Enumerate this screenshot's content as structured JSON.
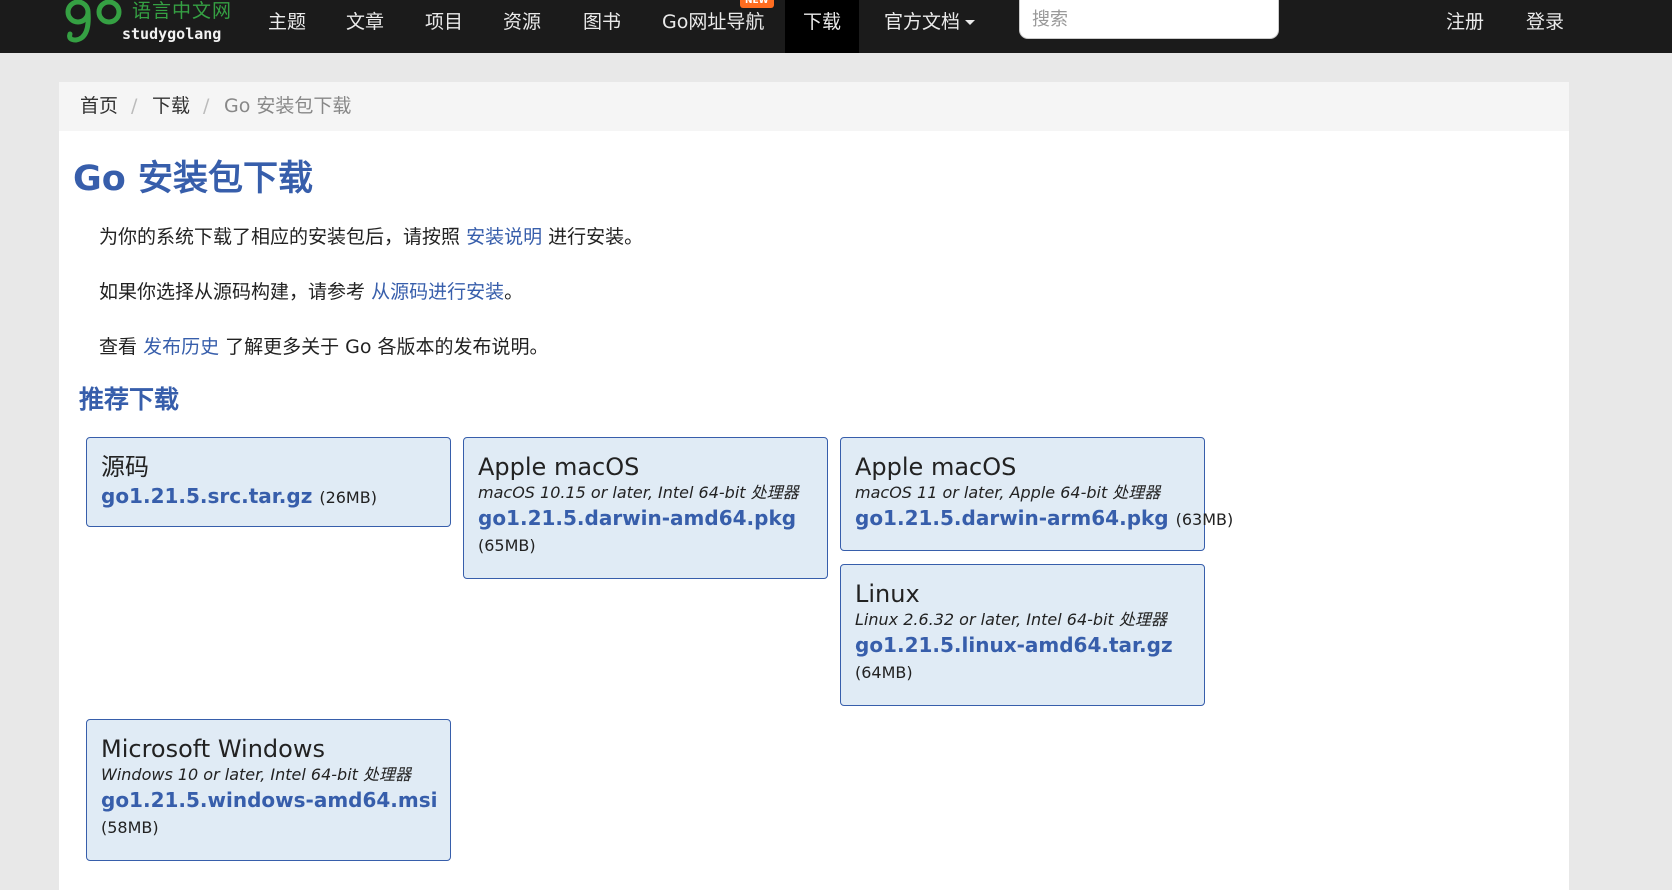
{
  "header": {
    "logo_cn": "语言中文网",
    "logo_en": "studygolang",
    "nav": [
      {
        "label": "主题"
      },
      {
        "label": "文章"
      },
      {
        "label": "项目"
      },
      {
        "label": "资源"
      },
      {
        "label": "图书"
      },
      {
        "label": "Go网址导航",
        "badge": "NEW"
      },
      {
        "label": "下载",
        "active": true
      },
      {
        "label": "官方文档"
      }
    ],
    "search_placeholder": "搜索",
    "register": "注册",
    "login": "登录"
  },
  "breadcrumb": {
    "home": "首页",
    "download": "下载",
    "sep": "/",
    "current": "Go 安装包下载"
  },
  "page_title": "Go 安装包下载",
  "paragraphs": {
    "p1_pre": "为你的系统下载了相应的安装包后，请按照",
    "p1_link": "安装说明",
    "p1_post": "进行安装。",
    "p2_pre": "如果你选择从源码构建，请参考",
    "p2_link": "从源码进行安装",
    "p2_post": "。",
    "p3_pre": "查看",
    "p3_link": "发布历史",
    "p3_post": "了解更多关于 Go 各版本的发布说明。"
  },
  "section_title": "推荐下载",
  "downloads": [
    {
      "os": "源码",
      "desc": "",
      "file": "go1.21.5.src.tar.gz",
      "size": "(26MB)"
    },
    {
      "os": "Apple macOS",
      "desc": "macOS 10.15 or later, Intel 64-bit 处理器",
      "file": "go1.21.5.darwin-amd64.pkg",
      "size": "(65MB)"
    },
    {
      "os": "Apple macOS",
      "desc": "macOS 11 or later, Apple 64-bit 处理器",
      "file": "go1.21.5.darwin-arm64.pkg",
      "size": "(63MB)"
    },
    {
      "os": "Linux",
      "desc": "Linux 2.6.32 or later, Intel 64-bit 处理器",
      "file": "go1.21.5.linux-amd64.tar.gz",
      "size": "(64MB)"
    },
    {
      "os": "Microsoft Windows",
      "desc": "Windows 10 or later, Intel 64-bit 处理器",
      "file": "go1.21.5.windows-amd64.msi",
      "size": "(58MB)"
    }
  ]
}
